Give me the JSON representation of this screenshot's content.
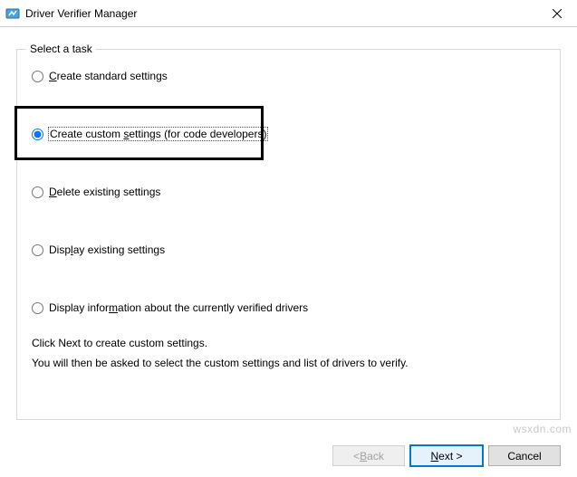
{
  "window": {
    "title": "Driver Verifier Manager"
  },
  "group": {
    "legend": "Select a task"
  },
  "options": {
    "standard": {
      "pre": "",
      "mn": "C",
      "post": "reate standard settings"
    },
    "custom": {
      "pre": "Create custom ",
      "mn": "s",
      "post": "ettings (for code developers)"
    },
    "delete": {
      "pre": "",
      "mn": "D",
      "post": "elete existing settings"
    },
    "display": {
      "pre": "Disp",
      "mn": "l",
      "post": "ay existing settings"
    },
    "info": {
      "pre": "Display infor",
      "mn": "m",
      "post": "ation about the currently verified drivers"
    }
  },
  "instructions": {
    "line1": "Click Next to create custom settings.",
    "line2": "You will then be asked to select the custom settings and list of drivers to verify."
  },
  "buttons": {
    "back": {
      "pre": "< ",
      "mn": "B",
      "post": "ack"
    },
    "next": {
      "pre": "",
      "mn": "N",
      "post": "ext >"
    },
    "cancel": {
      "label": "Cancel"
    }
  },
  "watermark": "wsxdn.com",
  "selected": "custom"
}
